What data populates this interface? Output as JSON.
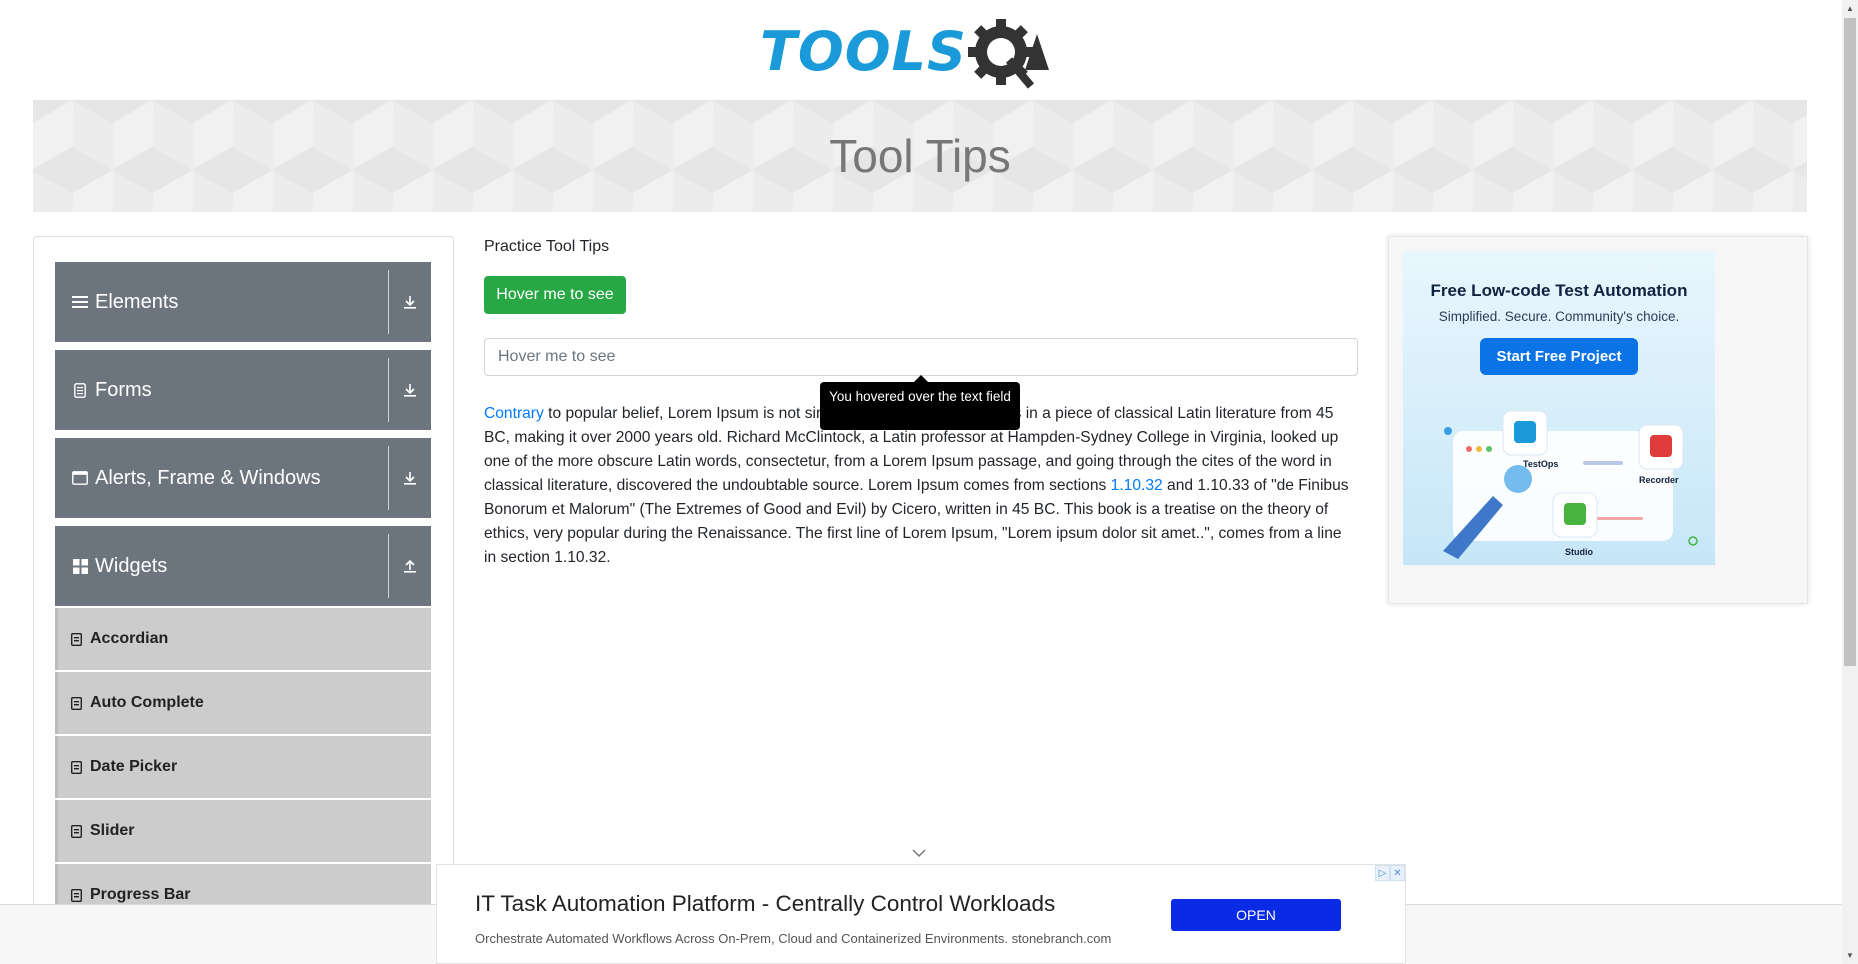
{
  "logo": {
    "text": "TOOLS",
    "text_q": "Q",
    "text_a": "A",
    "accent": "#1a9ad9",
    "dark": "#333333"
  },
  "page": {
    "title": "Tool Tips"
  },
  "sidebar": {
    "groups": [
      {
        "label": "Elements",
        "icon": "hamburger-icon",
        "arrow": "download-arrow-icon"
      },
      {
        "label": "Forms",
        "icon": "document-icon",
        "arrow": "download-arrow-icon"
      },
      {
        "label": "Alerts, Frame & Windows",
        "icon": "window-icon",
        "arrow": "download-arrow-icon"
      },
      {
        "label": "Widgets",
        "icon": "widgets-icon",
        "arrow": "upload-arrow-icon"
      }
    ],
    "items": [
      {
        "label": "Accordian"
      },
      {
        "label": "Auto Complete"
      },
      {
        "label": "Date Picker"
      },
      {
        "label": "Slider"
      },
      {
        "label": "Progress Bar"
      }
    ]
  },
  "main": {
    "section_title": "Practice Tool Tips",
    "hover_button": "Hover me to see",
    "text_field_placeholder": "Hover me to see",
    "tooltip": "You hovered over the text field",
    "paragraph": {
      "link1": "Contrary",
      "part1": " to popular belief, Lorem Ipsum is not simply random text. It has roots in a piece of classical Latin literature from 45 BC, making it over 2000 years old. Richard McClintock, a Latin professor at Hampden-Sydney College in Virginia, looked up one of the more obscure Latin words, consectetur, from a Lorem Ipsum passage, and going through the cites of the word in classical literature, discovered the undoubtable source. Lorem Ipsum comes from sections ",
      "link2": "1.10.32",
      "part2": " and 1.10.33 of \"de Finibus Bonorum et Malorum\" (The Extremes of Good and Evil) by Cicero, written in 45 BC. This book is a treatise on the theory of ethics, very popular during the Renaissance. The first line of Lorem Ipsum, \"Lorem ipsum dolor sit amet..\", comes from a line in section 1.10.32."
    }
  },
  "right_ad": {
    "title": "Free Low-code Test Automation",
    "subtitle": "Simplified. Secure. Community's choice.",
    "cta": "Start Free Project",
    "labels": [
      "TestOps",
      "Recorder",
      "Studio"
    ]
  },
  "bottom_ad": {
    "title": "IT Task Automation Platform - Centrally Control Workloads",
    "subtitle": "Orchestrate Automated Workflows Across On-Prem, Cloud and Containerized Environments. stonebranch.com",
    "open": "OPEN"
  },
  "colors": {
    "sidebar_group": "#6c757d",
    "sidebar_item": "#cccccc",
    "success": "#28a745",
    "link": "#007bff"
  }
}
